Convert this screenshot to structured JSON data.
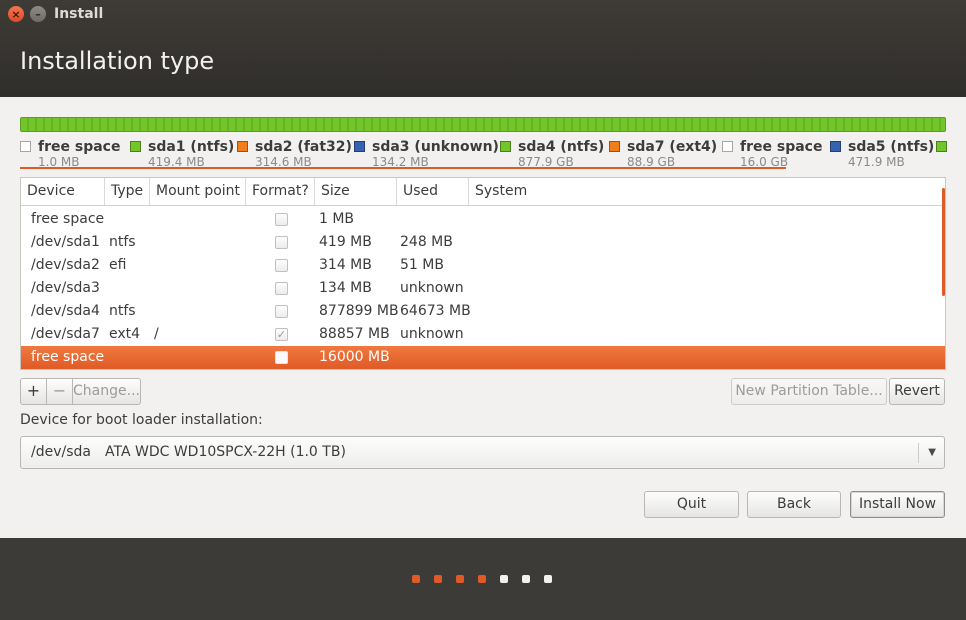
{
  "window": {
    "title": "Install",
    "close_glyph": "×",
    "minimize_glyph": "–"
  },
  "page_title": "Installation type",
  "colors": {
    "accent": "#e05a26",
    "free": "#ffffff",
    "fat32": "#f07e1b",
    "unknown": "#3563b0",
    "ntfs": "#72c52a",
    "ext4": "#f07e1b"
  },
  "legend": [
    {
      "name": "free space",
      "size": "1.0 MB",
      "color": "#ffffff"
    },
    {
      "name": "sda1 (ntfs)",
      "size": "419.4 MB",
      "color": "#72c52a"
    },
    {
      "name": "sda2 (fat32)",
      "size": "314.6 MB",
      "color": "#f07e1b"
    },
    {
      "name": "sda3 (unknown)",
      "size": "134.2 MB",
      "color": "#3563b0"
    },
    {
      "name": "sda4 (ntfs)",
      "size": "877.9 GB",
      "color": "#72c52a"
    },
    {
      "name": "sda7 (ext4)",
      "size": "88.9 GB",
      "color": "#f07e1b"
    },
    {
      "name": "free space",
      "size": "16.0 GB",
      "color": "#ffffff"
    },
    {
      "name": "sda5 (ntfs)",
      "size": "471.9 MB",
      "color": "#3563b0"
    }
  ],
  "table": {
    "headers": {
      "device": "Device",
      "type": "Type",
      "mount": "Mount point",
      "format": "Format?",
      "size": "Size",
      "used": "Used",
      "system": "System"
    },
    "rows": [
      {
        "device": "free space",
        "type": "",
        "mount": "",
        "format": false,
        "size": "1 MB",
        "used": "",
        "system": ""
      },
      {
        "device": "/dev/sda1",
        "type": "ntfs",
        "mount": "",
        "format": false,
        "size": "419 MB",
        "used": "248 MB",
        "system": ""
      },
      {
        "device": "/dev/sda2",
        "type": "efi",
        "mount": "",
        "format": false,
        "size": "314 MB",
        "used": "51 MB",
        "system": ""
      },
      {
        "device": "/dev/sda3",
        "type": "",
        "mount": "",
        "format": false,
        "size": "134 MB",
        "used": "unknown",
        "system": ""
      },
      {
        "device": "/dev/sda4",
        "type": "ntfs",
        "mount": "",
        "format": false,
        "size": "877899 MB",
        "used": "64673 MB",
        "system": ""
      },
      {
        "device": "/dev/sda7",
        "type": "ext4",
        "mount": "/",
        "format": true,
        "size": "88857 MB",
        "used": "unknown",
        "system": ""
      },
      {
        "device": "free space",
        "type": "",
        "mount": "",
        "format": false,
        "size": "16000 MB",
        "used": "",
        "system": "",
        "selected": true
      }
    ],
    "check_glyph": "✓"
  },
  "actions": {
    "add": "+",
    "remove": "−",
    "change": "Change...",
    "new_table": "New Partition Table...",
    "revert": "Revert"
  },
  "bootloader": {
    "label": "Device for boot loader installation:",
    "device": "/dev/sda",
    "model": "ATA WDC WD10SPCX-22H (1.0 TB)",
    "arrow_glyph": "▼"
  },
  "nav": {
    "quit": "Quit",
    "back": "Back",
    "install": "Install Now"
  },
  "progress": {
    "total_steps": 7,
    "current_step": 4,
    "done_color": "#e05a26",
    "todo_color": "#f2f1f0"
  }
}
